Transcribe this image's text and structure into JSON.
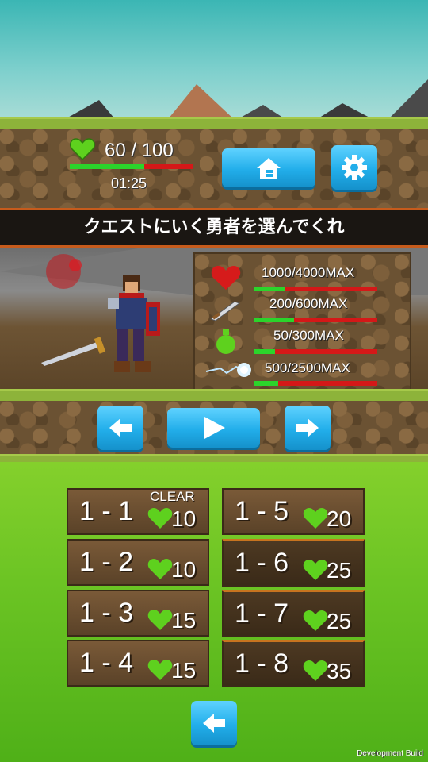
{
  "hud": {
    "hp_text": "60 / 100",
    "hp_current": 60,
    "hp_max": 100,
    "timer": "01:25"
  },
  "banner": {
    "text": "クエストにいく勇者を選んでくれ"
  },
  "stats": [
    {
      "icon": "heart-icon",
      "text": "1000/4000MAX",
      "fraction": 0.25
    },
    {
      "icon": "sword-icon",
      "text": "200/600MAX",
      "fraction": 0.33
    },
    {
      "icon": "potion-icon",
      "text": "50/300MAX",
      "fraction": 0.17
    },
    {
      "icon": "magic-icon",
      "text": "500/2500MAX",
      "fraction": 0.2
    }
  ],
  "levels": [
    {
      "name": "1 - 1",
      "cost": "10",
      "clear": "CLEAR"
    },
    {
      "name": "1 - 2",
      "cost": "10"
    },
    {
      "name": "1 - 3",
      "cost": "15"
    },
    {
      "name": "1 - 4",
      "cost": "15"
    },
    {
      "name": "1 - 5",
      "cost": "20"
    },
    {
      "name": "1 - 6",
      "cost": "25"
    },
    {
      "name": "1 - 7",
      "cost": "25"
    },
    {
      "name": "1 - 8",
      "cost": "35"
    }
  ],
  "footer": {
    "dev_build": "Development Build"
  },
  "colors": {
    "hp_green": "#2bd42b",
    "hp_red": "#d41818",
    "button_blue": "#22aeea",
    "heart_green": "#5ed11e"
  }
}
